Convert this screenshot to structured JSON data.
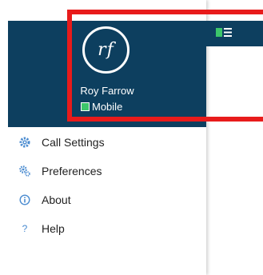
{
  "profile": {
    "initials": "rf",
    "name": "Roy Farrow",
    "presence": "Mobile"
  },
  "menu": {
    "items": [
      {
        "label": "Call Settings",
        "icon": "gear-icon"
      },
      {
        "label": "Preferences",
        "icon": "gears-icon"
      },
      {
        "label": "About",
        "icon": "info-icon"
      },
      {
        "label": "Help",
        "icon": "question-icon"
      }
    ]
  },
  "colors": {
    "header": "#0d3f5f",
    "presence": "#3cc66b",
    "accent": "#4a8bd0",
    "highlight": "#e81b1b"
  }
}
